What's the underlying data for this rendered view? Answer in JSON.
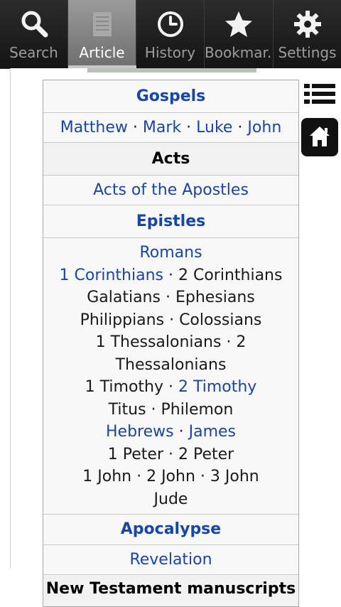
{
  "tabs": [
    {
      "label": "Search",
      "icon": "search-icon"
    },
    {
      "label": "Article",
      "icon": "article-icon"
    },
    {
      "label": "History",
      "icon": "clock-icon"
    },
    {
      "label": "Bookmar..",
      "icon": "star-icon"
    },
    {
      "label": "Settings",
      "icon": "gear-icon"
    }
  ],
  "navbox": {
    "gospels": {
      "heading": "Gospels",
      "items": [
        "Matthew",
        "Mark",
        "Luke",
        "John"
      ],
      "sep": " · "
    },
    "acts": {
      "heading": "Acts",
      "item": "Acts of the Apostles"
    },
    "epistles": {
      "heading": "Epistles",
      "romans": "Romans",
      "cor1": "1 Corinthians",
      "cor2": "2 Corinthians",
      "galatians": "Galatians",
      "ephesians": "Ephesians",
      "philippians": "Philippians",
      "colossians": "Colossians",
      "thess1": "1 Thessalonians",
      "thess2": "2 Thessalonians",
      "tim1": "1 Timothy",
      "tim2": "2 Timothy",
      "titus": "Titus",
      "philemon": "Philemon",
      "hebrews": "Hebrews",
      "james": "James",
      "peter1": "1 Peter",
      "peter2": "2 Peter",
      "john1": "1 John",
      "john2": "2 John",
      "john3": "3 John",
      "jude": "Jude"
    },
    "apocalypse": {
      "heading": "Apocalypse",
      "item": "Revelation"
    },
    "manuscripts": {
      "heading": "New Testament manuscripts"
    }
  },
  "colors": {
    "link": "#1845a8",
    "toolbar": "#141414",
    "active_tab": "#8a8a8a"
  }
}
